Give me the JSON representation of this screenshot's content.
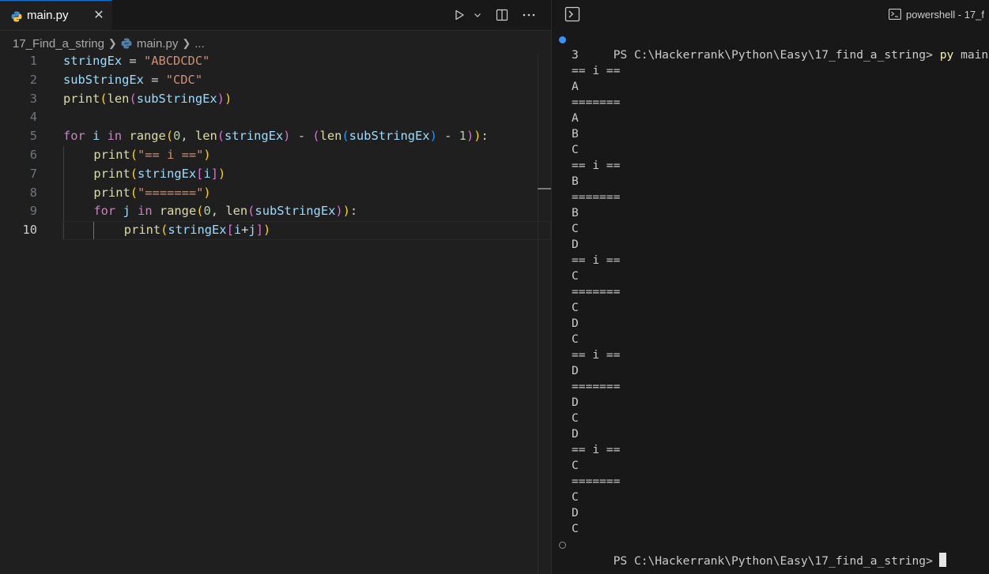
{
  "editor": {
    "tab": {
      "label": "main.py"
    },
    "breadcrumbs": {
      "folder": "17_Find_a_string",
      "file": "main.py",
      "more": "..."
    },
    "code_lines": [
      {
        "num": "1",
        "indent": 0,
        "tokens": [
          [
            "var",
            "stringEx"
          ],
          [
            "op",
            " = "
          ],
          [
            "str",
            "\"ABCDCDC\""
          ]
        ]
      },
      {
        "num": "2",
        "indent": 0,
        "tokens": [
          [
            "var",
            "subStringEx"
          ],
          [
            "op",
            " = "
          ],
          [
            "str",
            "\"CDC\""
          ]
        ]
      },
      {
        "num": "3",
        "indent": 0,
        "tokens": [
          [
            "fn",
            "print"
          ],
          [
            "p1",
            "("
          ],
          [
            "fn",
            "len"
          ],
          [
            "p2",
            "("
          ],
          [
            "var",
            "subStringEx"
          ],
          [
            "p2",
            ")"
          ],
          [
            "p1",
            ")"
          ]
        ]
      },
      {
        "num": "4",
        "indent": 0,
        "tokens": []
      },
      {
        "num": "5",
        "indent": 0,
        "tokens": [
          [
            "kw",
            "for"
          ],
          [
            "op",
            " "
          ],
          [
            "var",
            "i"
          ],
          [
            "op",
            " "
          ],
          [
            "kw",
            "in"
          ],
          [
            "op",
            " "
          ],
          [
            "fn",
            "range"
          ],
          [
            "p1",
            "("
          ],
          [
            "num",
            "0"
          ],
          [
            "op",
            ", "
          ],
          [
            "fn",
            "len"
          ],
          [
            "p2",
            "("
          ],
          [
            "var",
            "stringEx"
          ],
          [
            "p2",
            ")"
          ],
          [
            "op",
            " - "
          ],
          [
            "p2",
            "("
          ],
          [
            "fn",
            "len"
          ],
          [
            "p3",
            "("
          ],
          [
            "var",
            "subStringEx"
          ],
          [
            "p3",
            ")"
          ],
          [
            "op",
            " - "
          ],
          [
            "num",
            "1"
          ],
          [
            "p2",
            ")"
          ],
          [
            "p1",
            ")"
          ],
          [
            "op",
            ":"
          ]
        ]
      },
      {
        "num": "6",
        "indent": 1,
        "tokens": [
          [
            "fn",
            "print"
          ],
          [
            "p1",
            "("
          ],
          [
            "str",
            "\"== i ==\""
          ],
          [
            "p1",
            ")"
          ]
        ]
      },
      {
        "num": "7",
        "indent": 1,
        "tokens": [
          [
            "fn",
            "print"
          ],
          [
            "p1",
            "("
          ],
          [
            "var",
            "stringEx"
          ],
          [
            "p2",
            "["
          ],
          [
            "var",
            "i"
          ],
          [
            "p2",
            "]"
          ],
          [
            "p1",
            ")"
          ]
        ]
      },
      {
        "num": "8",
        "indent": 1,
        "tokens": [
          [
            "fn",
            "print"
          ],
          [
            "p1",
            "("
          ],
          [
            "str",
            "\"=======\""
          ],
          [
            "p1",
            ")"
          ]
        ]
      },
      {
        "num": "9",
        "indent": 1,
        "tokens": [
          [
            "kw",
            "for"
          ],
          [
            "op",
            " "
          ],
          [
            "var",
            "j"
          ],
          [
            "op",
            " "
          ],
          [
            "kw",
            "in"
          ],
          [
            "op",
            " "
          ],
          [
            "fn",
            "range"
          ],
          [
            "p1",
            "("
          ],
          [
            "num",
            "0"
          ],
          [
            "op",
            ", "
          ],
          [
            "fn",
            "len"
          ],
          [
            "p2",
            "("
          ],
          [
            "var",
            "subStringEx"
          ],
          [
            "p2",
            ")"
          ],
          [
            "p1",
            ")"
          ],
          [
            "op",
            ":"
          ]
        ]
      },
      {
        "num": "10",
        "indent": 2,
        "tokens": [
          [
            "fn",
            "print"
          ],
          [
            "p1",
            "("
          ],
          [
            "var",
            "stringEx"
          ],
          [
            "p2",
            "["
          ],
          [
            "var",
            "i"
          ],
          [
            "op",
            "+"
          ],
          [
            "var",
            "j"
          ],
          [
            "p2",
            "]"
          ],
          [
            "p1",
            ")"
          ]
        ]
      }
    ],
    "active_line": "10"
  },
  "terminal": {
    "tab_label": "powershell - 17_f",
    "prompt": "PS C:\\Hackerrank\\Python\\Easy\\17_find_a_string>",
    "command_name": "py",
    "command_args": "main.py",
    "output": [
      "3",
      "== i ==",
      "A",
      "=======",
      "A",
      "B",
      "C",
      "== i ==",
      "B",
      "=======",
      "B",
      "C",
      "D",
      "== i ==",
      "C",
      "=======",
      "C",
      "D",
      "C",
      "== i ==",
      "D",
      "=======",
      "D",
      "C",
      "D",
      "== i ==",
      "C",
      "=======",
      "C",
      "D",
      "C"
    ],
    "final_prompt": "PS C:\\Hackerrank\\Python\\Easy\\17_find_a_string>"
  }
}
